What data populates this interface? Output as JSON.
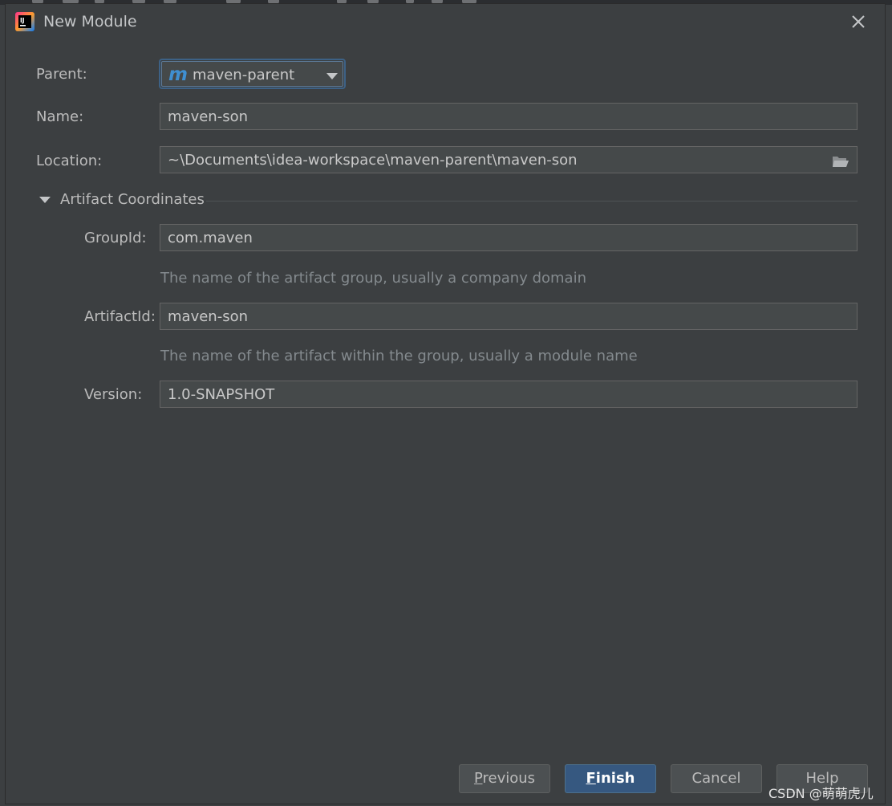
{
  "dialog": {
    "title": "New Module",
    "app_icon": "intellij-idea-icon",
    "close_icon": "close-icon"
  },
  "form": {
    "parent": {
      "label": "Parent:",
      "value": "maven-parent",
      "icon": "maven-m-icon",
      "icon_glyph": "m"
    },
    "name": {
      "label": "Name:",
      "value": "maven-son"
    },
    "location": {
      "label": "Location:",
      "value": "~\\Documents\\idea-workspace\\maven-parent\\maven-son",
      "browse_icon": "folder-icon"
    }
  },
  "artifact": {
    "section_title": "Artifact Coordinates",
    "expanded": true,
    "group_id": {
      "label": "GroupId:",
      "value": "com.maven",
      "hint": "The name of the artifact group, usually a company domain"
    },
    "artifact_id": {
      "label": "ArtifactId:",
      "value": "maven-son",
      "hint": "The name of the artifact within the group, usually a module name"
    },
    "version": {
      "label": "Version:",
      "value": "1.0-SNAPSHOT"
    }
  },
  "buttons": {
    "previous": {
      "mnemonic": "P",
      "rest": "revious"
    },
    "finish": {
      "mnemonic": "F",
      "rest": "inish"
    },
    "cancel": {
      "label": "Cancel"
    },
    "help": {
      "label": "Help"
    }
  },
  "watermark": "CSDN @萌萌虎儿",
  "colors": {
    "background": "#3c3f41",
    "field_bg": "#45494a",
    "primary_button": "#365880",
    "focus_border": "#3d6185",
    "maven_icon": "#3f8fd1"
  }
}
